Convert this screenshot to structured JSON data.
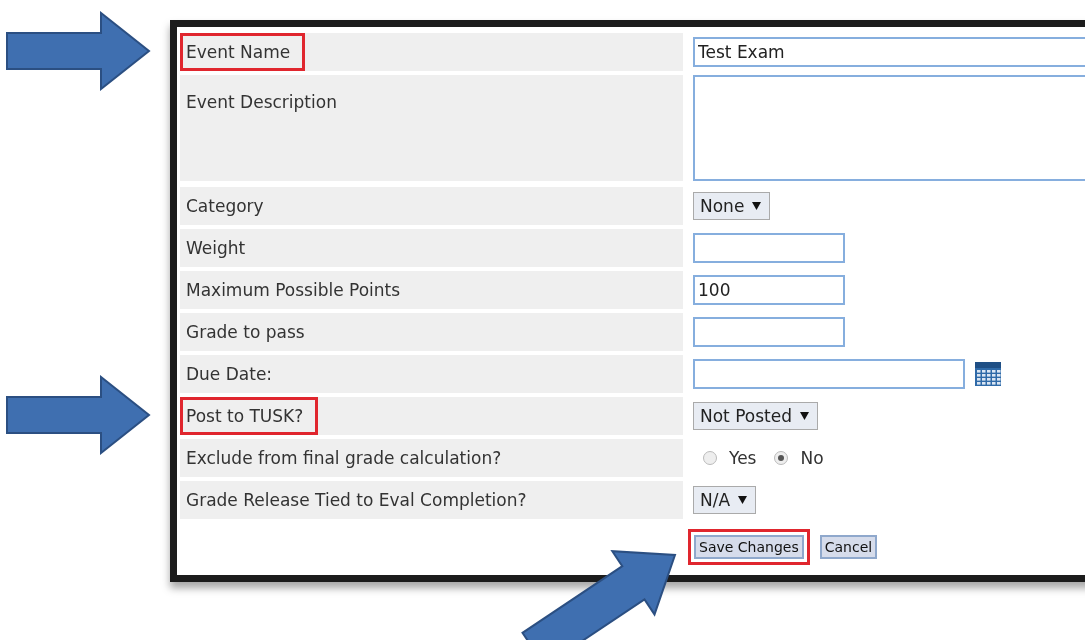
{
  "fields": [
    {
      "kind": "wide_text",
      "label": "Event Name",
      "value": "Test Exam",
      "highlighted": true
    },
    {
      "kind": "textarea",
      "label": "Event Description",
      "highlighted": false
    },
    {
      "kind": "select",
      "label": "Category",
      "value": "None",
      "highlighted": false
    },
    {
      "kind": "text",
      "label": "Weight",
      "highlighted": false
    },
    {
      "kind": "text",
      "label": "Maximum Possible Points",
      "value": "100",
      "highlighted": false
    },
    {
      "kind": "text",
      "label": "Grade to pass",
      "highlighted": false
    },
    {
      "kind": "date",
      "label": "Due Date:",
      "highlighted": false
    },
    {
      "kind": "select",
      "label": "Post to TUSK?",
      "value": "Not Posted",
      "highlighted": true
    },
    {
      "kind": "radio",
      "label": "Exclude from final grade calculation?",
      "highlighted": false,
      "options": [
        {
          "label": "Yes",
          "selected": false
        },
        {
          "label": "No",
          "selected": true
        }
      ]
    },
    {
      "kind": "select",
      "label": "Grade Release Tied to Eval Completion?",
      "value": "N/A",
      "highlighted": false
    }
  ],
  "buttons": [
    {
      "label": "Save Changes",
      "highlighted": true
    },
    {
      "label": "Cancel",
      "highlighted": false
    }
  ]
}
